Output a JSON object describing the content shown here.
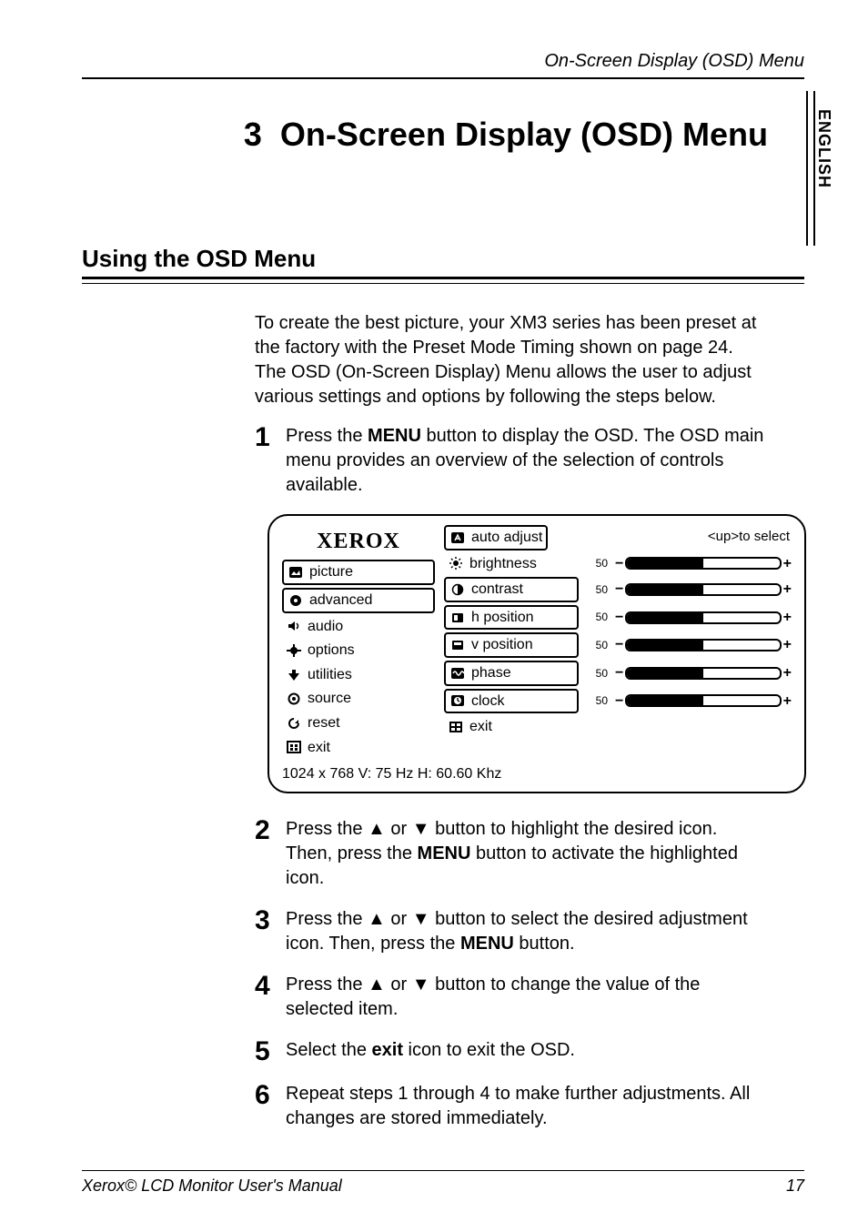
{
  "header": {
    "running": "On-Screen Display (OSD) Menu"
  },
  "side_tab": "ENGLISH",
  "chapter": {
    "num": "3",
    "title": "On-Screen Display (OSD) Menu"
  },
  "section": {
    "title": "Using the OSD Menu"
  },
  "intro": "To create the best picture, your XM3 series has been preset at the factory with the Preset Mode Timing shown on page 24. The OSD (On-Screen Display) Menu allows the user to adjust various settings and options by following the steps below.",
  "steps": [
    {
      "num": "1",
      "pre": "Press the ",
      "bold": "MENU",
      "post": " button to display the OSD. The OSD main menu provides an overview of the selection of controls available."
    },
    {
      "num": "2",
      "pre": "Press the ▲ or ▼ button to highlight the desired icon.  Then, press the ",
      "bold": "MENU",
      "post": " button to activate the highlighted icon."
    },
    {
      "num": "3",
      "pre": "Press the ▲ or ▼ button to select the desired adjustment icon. Then, press the ",
      "bold": "MENU",
      "post": " button."
    },
    {
      "num": "4",
      "pre": "Press the ▲ or ▼ button to change the value of the selected item.",
      "bold": "",
      "post": ""
    },
    {
      "num": "5",
      "pre": "Select the ",
      "bold": "exit",
      "post": " icon to exit the OSD."
    },
    {
      "num": "6",
      "pre": "Repeat steps 1 through 4 to make further adjustments. All changes are stored immediately.",
      "bold": "",
      "post": ""
    }
  ],
  "osd": {
    "brand": "XEROX",
    "select_hint": "<up>to select",
    "categories": [
      "picture",
      "advanced",
      "audio",
      "options",
      "utilities",
      "source",
      "reset",
      "exit"
    ],
    "top_item": {
      "label": "auto adjust"
    },
    "rows": [
      {
        "icon": "brightness",
        "label": "brightness",
        "value": 50,
        "fill": 50
      },
      {
        "icon": "contrast",
        "label": "contrast",
        "value": 50,
        "fill": 50
      },
      {
        "icon": "hpos",
        "label": "h position",
        "value": 50,
        "fill": 50
      },
      {
        "icon": "vpos",
        "label": "v position",
        "value": 50,
        "fill": 50
      },
      {
        "icon": "phase",
        "label": "phase",
        "value": 50,
        "fill": 50
      },
      {
        "icon": "clock",
        "label": "clock",
        "value": 50,
        "fill": 50
      }
    ],
    "exit_label": "exit",
    "mode": "1024 x 768 V: 75 Hz   H: 60.60 Khz"
  },
  "footer": {
    "left": "Xerox© LCD Monitor User's Manual",
    "page": "17"
  }
}
